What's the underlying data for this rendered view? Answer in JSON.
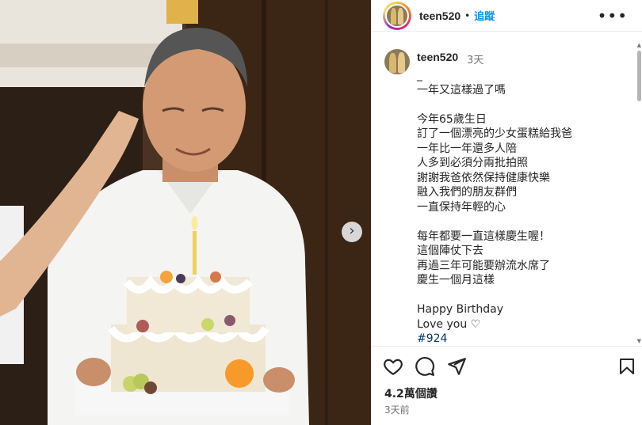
{
  "post": {
    "username": "teen520",
    "follow_label": "追蹤",
    "separator": "•",
    "more_label": "•••"
  },
  "caption": {
    "username": "teen520",
    "time": "3天",
    "text": "_\n一年又這樣過了嗎\n\n今年65歲生日\n訂了一個漂亮的少女蛋糕給我爸\n一年比一年還多人陪\n人多到必須分兩批拍照\n謝謝我爸依然保持健康快樂\n融入我們的朋友群們\n一直保持年輕的心\n\n每年都要一直這樣慶生喔！\n這個陣仗下去\n再過三年可能要辦流水席了\n慶生一個月這樣\n\nHappy Birthday\nLove you ♡\n",
    "hashtag": "#924"
  },
  "stats": {
    "likes": "4.2萬個讚",
    "posted": "3天前"
  },
  "icons": {
    "like": "heart-icon",
    "comment": "comment-icon",
    "share": "share-icon",
    "save": "bookmark-icon",
    "next": "chevron-right-icon"
  },
  "colors": {
    "follow": "#0095f6",
    "text": "#262626",
    "muted": "#737373"
  }
}
